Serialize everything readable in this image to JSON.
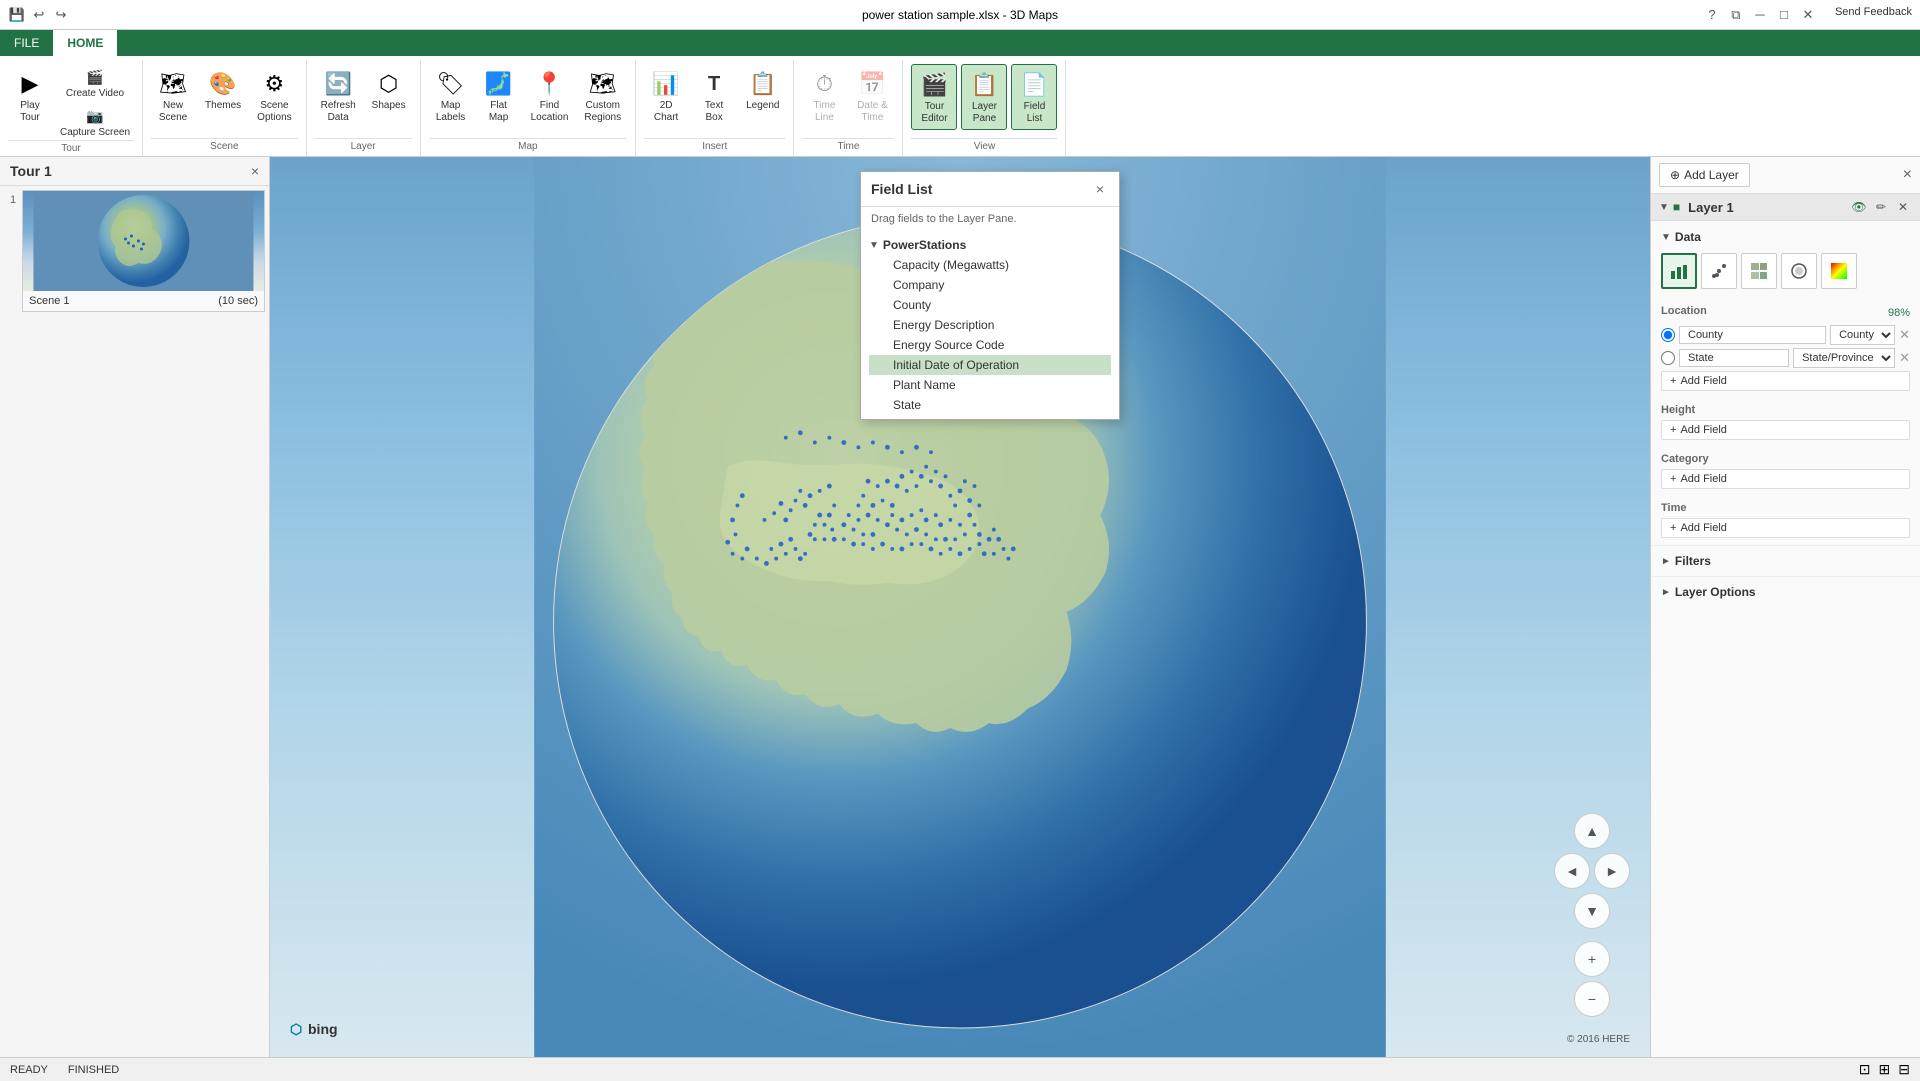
{
  "titlebar": {
    "title": "power station sample.xlsx - 3D Maps",
    "feedback": "Send Feedback"
  },
  "quickaccess": [
    "undo",
    "redo",
    "save"
  ],
  "ribbon": {
    "tabs": [
      {
        "id": "file",
        "label": "FILE"
      },
      {
        "id": "home",
        "label": "HOME",
        "active": true
      }
    ],
    "groups": {
      "tour": {
        "label": "Tour",
        "items": [
          {
            "id": "play-tour",
            "label": "Play\nTour",
            "icon": "▶"
          },
          {
            "id": "create-video",
            "label": "Create\nVideo",
            "icon": "🎬"
          },
          {
            "id": "capture-screen",
            "label": "Capture\nScreen",
            "icon": "📷"
          }
        ]
      },
      "scene": {
        "label": "Scene",
        "items": [
          {
            "id": "new-scene",
            "label": "New\nScene",
            "icon": "🗺"
          },
          {
            "id": "themes",
            "label": "Themes",
            "icon": "🎨"
          },
          {
            "id": "scene-options",
            "label": "Scene\nOptions",
            "icon": "⚙"
          }
        ]
      },
      "layer": {
        "label": "Layer",
        "items": [
          {
            "id": "refresh-data",
            "label": "Refresh\nData",
            "icon": "🔄"
          },
          {
            "id": "shapes",
            "label": "Shapes",
            "icon": "⬡"
          }
        ]
      },
      "map": {
        "label": "Map",
        "items": [
          {
            "id": "map-labels",
            "label": "Map\nLabels",
            "icon": "🏷"
          },
          {
            "id": "flat-map",
            "label": "Flat\nMap",
            "icon": "🗾"
          },
          {
            "id": "find-location",
            "label": "Find\nLocation",
            "icon": "📍"
          },
          {
            "id": "custom-regions",
            "label": "Custom\nRegions",
            "icon": "🗺"
          }
        ]
      },
      "insert": {
        "label": "Insert",
        "items": [
          {
            "id": "2d-chart",
            "label": "2D\nChart",
            "icon": "📊"
          },
          {
            "id": "text-box",
            "label": "Text\nBox",
            "icon": "T"
          },
          {
            "id": "legend",
            "label": "Legend",
            "icon": "📋"
          }
        ]
      },
      "time": {
        "label": "Time",
        "items": [
          {
            "id": "time-line",
            "label": "Time\nLine",
            "icon": "⏱",
            "disabled": true
          },
          {
            "id": "date-time",
            "label": "Date &\nTime",
            "icon": "📅",
            "disabled": true
          }
        ]
      },
      "view": {
        "label": "View",
        "items": [
          {
            "id": "tour-editor",
            "label": "Tour\nEditor",
            "icon": "🎬",
            "active": true
          },
          {
            "id": "layer-pane",
            "label": "Layer\nPane",
            "icon": "📋",
            "active": true
          },
          {
            "id": "field-list",
            "label": "Field\nList",
            "icon": "📄",
            "active": true
          }
        ]
      }
    }
  },
  "tour_panel": {
    "title": "Tour 1",
    "scene": {
      "number": "1",
      "name": "Scene 1",
      "duration": "(10 sec)"
    }
  },
  "field_list": {
    "title": "Field List",
    "subtitle": "Drag fields to the Layer Pane.",
    "close_label": "×",
    "table": {
      "name": "PowerStations",
      "fields": [
        "Capacity (Megawatts)",
        "Company",
        "County",
        "Energy Description",
        "Energy Source Code",
        "Initial Date of Operation",
        "Plant Name",
        "State"
      ]
    }
  },
  "layer_pane": {
    "add_layer_label": "Add Layer",
    "close_label": "×",
    "layer": {
      "name": "Layer 1",
      "data_section": "Data",
      "location": {
        "label": "Location",
        "pct": "98%",
        "fields": [
          {
            "id": "county",
            "label": "County",
            "mapping": "County",
            "active": true
          },
          {
            "id": "state",
            "label": "State",
            "mapping": "State/Province",
            "active": false
          }
        ]
      },
      "height": {
        "label": "Height",
        "placeholder": "Add Field"
      },
      "category": {
        "label": "Category",
        "placeholder": "Add Field"
      },
      "time_field": {
        "label": "Time",
        "placeholder": "Add Field"
      },
      "filters_label": "Filters",
      "layer_options_label": "Layer Options"
    },
    "viz_icons": [
      "bar",
      "scatter",
      "region",
      "bubble",
      "heat"
    ]
  },
  "status_bar": {
    "ready": "READY",
    "finished": "FINISHED"
  },
  "map": {
    "bing_logo": "⬡ bing",
    "copyright": "© 2016 HERE"
  }
}
